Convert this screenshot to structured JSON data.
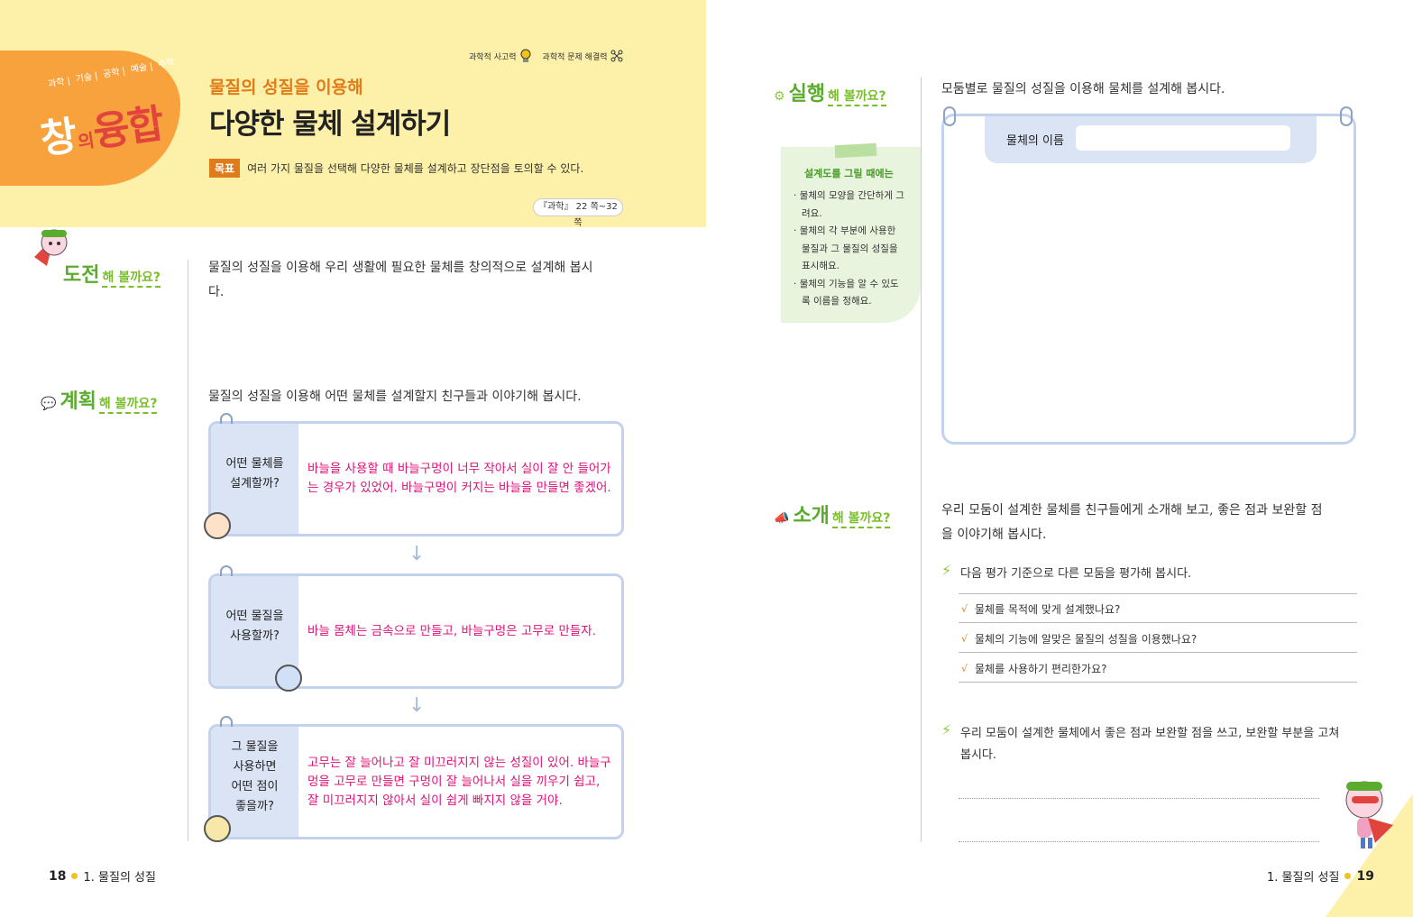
{
  "left": {
    "brand": {
      "subjects": [
        "과학",
        "기술",
        "공학",
        "예술",
        "수학"
      ],
      "name_part1": "창",
      "name_part2": "의",
      "name_part3": "융합"
    },
    "skills": [
      "과학적 사고력",
      "과학적 문제 해결력"
    ],
    "subtitle": "물질의 성질을 이용해",
    "title": "다양한 물체 설계하기",
    "goal_tag": "목표",
    "goal_text": "여러 가지 물질을 선택해 다양한 물체를 설계하고 장단점을 토의할 수 있다.",
    "reference": "『과학』 22 쪽~32 쪽",
    "challenge": {
      "label_big": "도전",
      "label_small": "해 볼까요?",
      "text_line1": "물질의 성질을 이용해 우리 생활에 필요한 물체를 창의적으로 설계해 봅시",
      "text_line2": "다."
    },
    "plan": {
      "label_big": "계획",
      "label_small": "해 볼까요?",
      "intro": "물질의 성질을 이용해 어떤 물체를 설계할지 친구들과 이야기해 봅시다.",
      "cards": [
        {
          "question_line1": "어떤 물체를",
          "question_line2": "설계할까?",
          "question_line3": "",
          "question_line4": "",
          "answer": "바늘을 사용할 때 바늘구멍이 너무 작아서 실이 잘 안 들어가는 경우가 있었어. 바늘구멍이 커지는 바늘을 만들면 좋겠어."
        },
        {
          "question_line1": "어떤 물질을",
          "question_line2": "사용할까?",
          "question_line3": "",
          "question_line4": "",
          "answer": "바늘 몸체는 금속으로 만들고, 바늘구멍은 고무로 만들자."
        },
        {
          "question_line1": "그 물질을",
          "question_line2": "사용하면",
          "question_line3": "어떤 점이",
          "question_line4": "좋을까?",
          "answer": "고무는 잘 늘어나고 잘 미끄러지지 않는 성질이 있어. 바늘구멍을 고무로 만들면 구멍이 잘 늘어나서 실을 끼우기 쉽고, 잘 미끄러지지 않아서 실이 쉽게 빠지지 않을 거야."
        }
      ]
    },
    "page_number": "18",
    "chapter": "1. 물질의 성질"
  },
  "right": {
    "execute": {
      "label_big": "실행",
      "label_small": "해 볼까요?",
      "intro": "모둠별로 물질의 성질을 이용해 물체를 설계해 봅시다.",
      "name_label": "물체의 이름",
      "name_value": ""
    },
    "memo": {
      "title": "설계도를 그릴 때에는",
      "items": [
        "물체의 모양을 간단하게 그려요.",
        "물체의 각 부분에 사용한 물질과 그 물질의 성질을 표시해요.",
        "물체의 기능을 알 수 있도록 이름을 정해요."
      ]
    },
    "introduce": {
      "label_big": "소개",
      "label_small": "해 볼까요?",
      "intro_line1": "우리 모둠이 설계한 물체를 친구들에게 소개해 보고, 좋은 점과 보완할 점",
      "intro_line2": "을 이야기해 봅시다.",
      "eval_prompt": "다음 평가 기준으로 다른 모둠을 평가해 봅시다.",
      "check_mark": "√",
      "criteria": [
        "물체를 목적에 맞게 설계했나요?",
        "물체의 기능에 알맞은 물질의 성질을 이용했나요?",
        "물체를 사용하기 편리한가요?"
      ],
      "write_prompt_line1": "우리 모둠이 설계한 물체에서 좋은 점과 보완할 점을 쓰고, 보완할 부분을 고쳐",
      "write_prompt_line2": "봅시다."
    },
    "page_number": "19",
    "chapter": "1. 물질의 성질"
  },
  "colors": {
    "header_yellow": "#fdf1a9",
    "brand_orange": "#f7a23c",
    "section_green": "#5bab2f",
    "answer_pink": "#e0117a",
    "card_blue": "#c3d3ef"
  }
}
